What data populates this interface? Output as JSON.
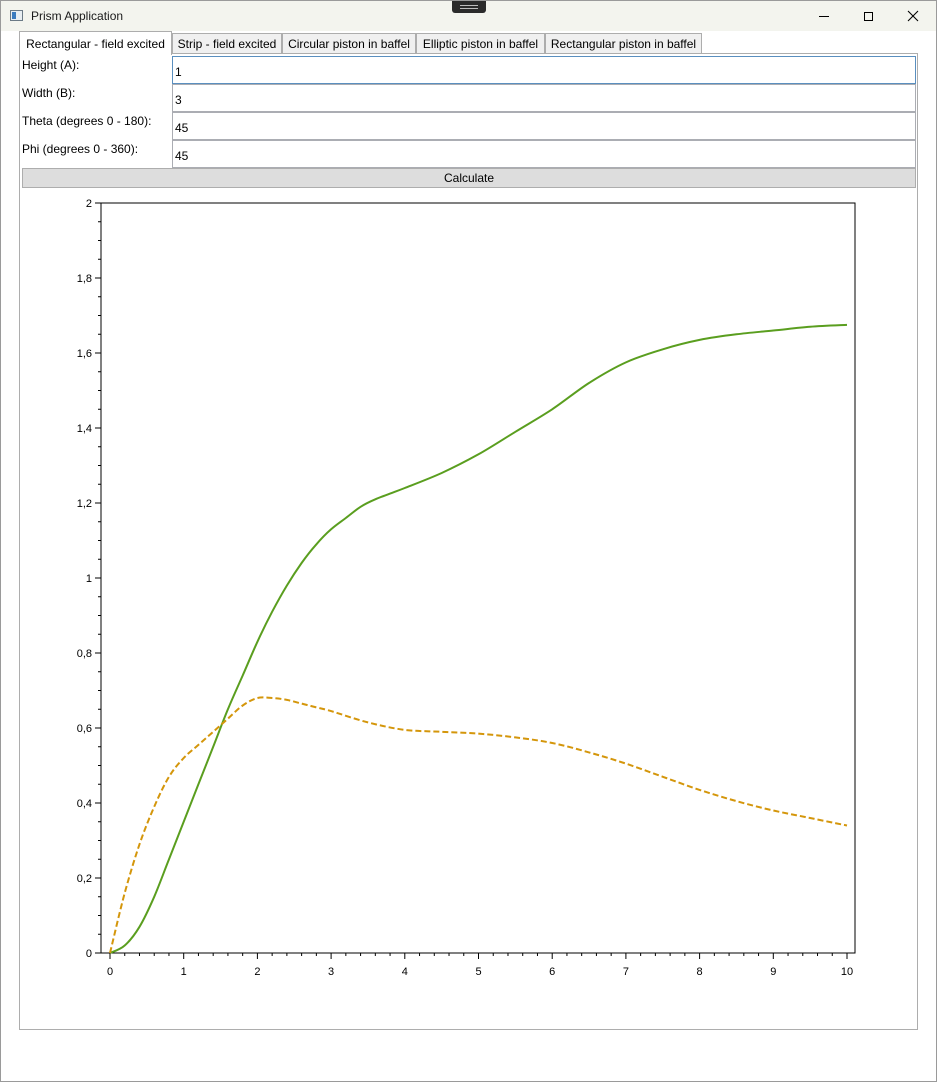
{
  "window": {
    "title": "Prism Application"
  },
  "tabs": [
    {
      "label": "Rectangular - field excited",
      "active": true
    },
    {
      "label": "Strip - field excited",
      "active": false
    },
    {
      "label": "Circular piston in baffel",
      "active": false
    },
    {
      "label": "Elliptic piston in baffel",
      "active": false
    },
    {
      "label": "Rectangular piston in baffel",
      "active": false
    }
  ],
  "form": {
    "height": {
      "label": "Height (A):",
      "value": "1"
    },
    "width": {
      "label": "Width (B):",
      "value": "3"
    },
    "theta": {
      "label": "Theta (degrees 0 - 180):",
      "value": "45"
    },
    "phi": {
      "label": "Phi (degrees 0 - 360):",
      "value": "45"
    },
    "calculate_label": "Calculate"
  },
  "chart_data": {
    "type": "line",
    "title": "",
    "xlabel": "",
    "ylabel": "",
    "xlim": [
      0,
      10
    ],
    "ylim": [
      0,
      2
    ],
    "x_ticks": [
      "0",
      "1",
      "2",
      "3",
      "4",
      "5",
      "6",
      "7",
      "8",
      "9",
      "10"
    ],
    "y_ticks": [
      "0",
      "0,2",
      "0,4",
      "0,6",
      "0,8",
      "1",
      "1,2",
      "1,4",
      "1,6",
      "1,8",
      "2"
    ],
    "grid": false,
    "series": [
      {
        "color": "#5a9e1f",
        "style": "solid",
        "x": [
          0,
          0.2,
          0.4,
          0.6,
          0.8,
          1.0,
          1.2,
          1.4,
          1.6,
          1.8,
          2.0,
          2.2,
          2.4,
          2.6,
          2.8,
          3.0,
          3.2,
          3.4,
          3.6,
          3.8,
          4.0,
          4.5,
          5.0,
          5.5,
          6.0,
          6.5,
          7.0,
          7.5,
          8.0,
          8.5,
          9.0,
          9.5,
          10.0
        ],
        "y": [
          0,
          0.02,
          0.07,
          0.15,
          0.25,
          0.35,
          0.45,
          0.55,
          0.65,
          0.74,
          0.83,
          0.91,
          0.98,
          1.04,
          1.09,
          1.13,
          1.16,
          1.19,
          1.21,
          1.225,
          1.24,
          1.28,
          1.33,
          1.39,
          1.45,
          1.52,
          1.575,
          1.61,
          1.635,
          1.65,
          1.66,
          1.67,
          1.675
        ]
      },
      {
        "color": "#d4960b",
        "style": "dashed",
        "x": [
          0,
          0.2,
          0.4,
          0.6,
          0.8,
          1.0,
          1.2,
          1.4,
          1.6,
          1.8,
          2.0,
          2.2,
          2.4,
          2.6,
          2.8,
          3.0,
          3.5,
          4.0,
          4.5,
          5.0,
          5.5,
          6.0,
          6.5,
          7.0,
          7.5,
          8.0,
          8.5,
          9.0,
          9.5,
          10.0
        ],
        "y": [
          0,
          0.16,
          0.29,
          0.39,
          0.47,
          0.52,
          0.555,
          0.59,
          0.625,
          0.66,
          0.68,
          0.68,
          0.675,
          0.665,
          0.655,
          0.645,
          0.615,
          0.595,
          0.59,
          0.585,
          0.575,
          0.56,
          0.535,
          0.505,
          0.47,
          0.435,
          0.405,
          0.38,
          0.36,
          0.34
        ]
      }
    ]
  }
}
